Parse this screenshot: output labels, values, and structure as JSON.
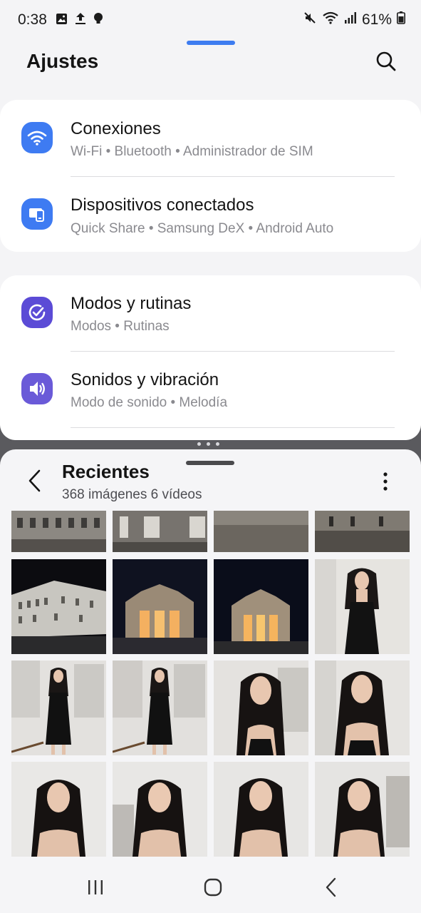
{
  "status_bar": {
    "time": "0:38",
    "battery": "61%",
    "left_icons": [
      "gallery-icon",
      "upload-icon",
      "bulb-icon"
    ],
    "right_icons": [
      "mute-icon",
      "wifi-icon",
      "signal-icon",
      "battery-icon"
    ]
  },
  "settings": {
    "title": "Ajustes",
    "search_icon": "search-icon",
    "items": [
      {
        "title": "Conexiones",
        "subtitle": "Wi-Fi • Bluetooth • Administrador de SIM",
        "icon": "wifi-icon",
        "icon_color": "#3e7bf2"
      },
      {
        "title": "Dispositivos conectados",
        "subtitle": "Quick Share • Samsung DeX • Android Auto",
        "icon": "devices-icon",
        "icon_color": "#3e7bf2"
      },
      {
        "title": "Modos y rutinas",
        "subtitle": "Modos • Rutinas",
        "icon": "check-circle-icon",
        "icon_color": "#5b4bd6"
      },
      {
        "title": "Sonidos y vibración",
        "subtitle": "Modo de sonido • Melodía",
        "icon": "speaker-icon",
        "icon_color": "#6a5ad8"
      }
    ]
  },
  "gallery": {
    "title": "Recientes",
    "count": "368 imágenes 6 vídeos",
    "back_icon": "chevron-left-icon",
    "more_icon": "more-vertical-icon"
  },
  "nav_bar": {
    "recents_icon": "recent-apps-icon",
    "home_icon": "home-icon",
    "back_icon": "back-icon"
  },
  "colors": {
    "accent": "#3e7bf2",
    "background": "#f4f4f6",
    "card": "#ffffff",
    "divider_bg": "#5a5a5e"
  }
}
